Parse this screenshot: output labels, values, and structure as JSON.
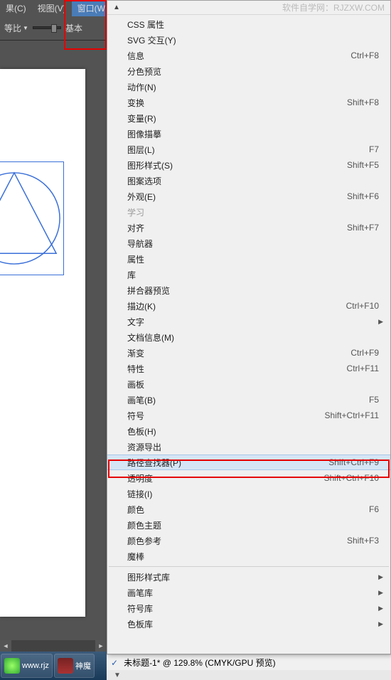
{
  "menubar": {
    "items": [
      {
        "label": "果(C)"
      },
      {
        "label": "视图(V)"
      },
      {
        "label": "窗口(W)"
      }
    ]
  },
  "toolbar": {
    "ratio_label": "等比",
    "basic_label": "基本"
  },
  "watermark": "软件自学网：RJZXW.COM",
  "menu": {
    "groups": [
      [
        {
          "label": "CSS 属性",
          "shortcut": "",
          "sub": false
        },
        {
          "label": "SVG 交互(Y)",
          "shortcut": "",
          "sub": false
        },
        {
          "label": "信息",
          "shortcut": "Ctrl+F8",
          "sub": false
        },
        {
          "label": "分色预览",
          "shortcut": "",
          "sub": false
        },
        {
          "label": "动作(N)",
          "shortcut": "",
          "sub": false
        },
        {
          "label": "变换",
          "shortcut": "Shift+F8",
          "sub": false
        },
        {
          "label": "变量(R)",
          "shortcut": "",
          "sub": false
        },
        {
          "label": "图像描摹",
          "shortcut": "",
          "sub": false
        },
        {
          "label": "图层(L)",
          "shortcut": "F7",
          "sub": false
        },
        {
          "label": "图形样式(S)",
          "shortcut": "Shift+F5",
          "sub": false
        },
        {
          "label": "图案选项",
          "shortcut": "",
          "sub": false
        },
        {
          "label": "外观(E)",
          "shortcut": "Shift+F6",
          "sub": false
        },
        {
          "label": "学习",
          "shortcut": "",
          "sub": false,
          "disabled": true
        },
        {
          "label": "对齐",
          "shortcut": "Shift+F7",
          "sub": false
        },
        {
          "label": "导航器",
          "shortcut": "",
          "sub": false
        },
        {
          "label": "属性",
          "shortcut": "",
          "sub": false
        },
        {
          "label": "库",
          "shortcut": "",
          "sub": false
        },
        {
          "label": "拼合器预览",
          "shortcut": "",
          "sub": false
        },
        {
          "label": "描边(K)",
          "shortcut": "Ctrl+F10",
          "sub": false
        },
        {
          "label": "文字",
          "shortcut": "",
          "sub": true
        },
        {
          "label": "文档信息(M)",
          "shortcut": "",
          "sub": false
        },
        {
          "label": "渐变",
          "shortcut": "Ctrl+F9",
          "sub": false
        },
        {
          "label": "特性",
          "shortcut": "Ctrl+F11",
          "sub": false
        },
        {
          "label": "画板",
          "shortcut": "",
          "sub": false
        },
        {
          "label": "画笔(B)",
          "shortcut": "F5",
          "sub": false
        },
        {
          "label": "符号",
          "shortcut": "Shift+Ctrl+F11",
          "sub": false
        },
        {
          "label": "色板(H)",
          "shortcut": "",
          "sub": false
        },
        {
          "label": "资源导出",
          "shortcut": "",
          "sub": false
        },
        {
          "label": "路径查找器(P)",
          "shortcut": "Shift+Ctrl+F9",
          "sub": false,
          "highlight": true
        },
        {
          "label": "透明度",
          "shortcut": "Shift+Ctrl+F10",
          "sub": false
        },
        {
          "label": "链接(I)",
          "shortcut": "",
          "sub": false
        },
        {
          "label": "颜色",
          "shortcut": "F6",
          "sub": false
        },
        {
          "label": "颜色主题",
          "shortcut": "",
          "sub": false
        },
        {
          "label": "颜色参考",
          "shortcut": "Shift+F3",
          "sub": false
        },
        {
          "label": "魔棒",
          "shortcut": "",
          "sub": false
        }
      ],
      [
        {
          "label": "图形样式库",
          "shortcut": "",
          "sub": true
        },
        {
          "label": "画笔库",
          "shortcut": "",
          "sub": true
        },
        {
          "label": "符号库",
          "shortcut": "",
          "sub": true
        },
        {
          "label": "色板库",
          "shortcut": "",
          "sub": true
        }
      ]
    ]
  },
  "windows_item": {
    "label": "未标题-1* @ 129.8% (CMYK/GPU 预览)",
    "checked": true
  },
  "taskbar": {
    "items": [
      {
        "label": "www.rjz"
      },
      {
        "label": "神魔"
      }
    ]
  }
}
